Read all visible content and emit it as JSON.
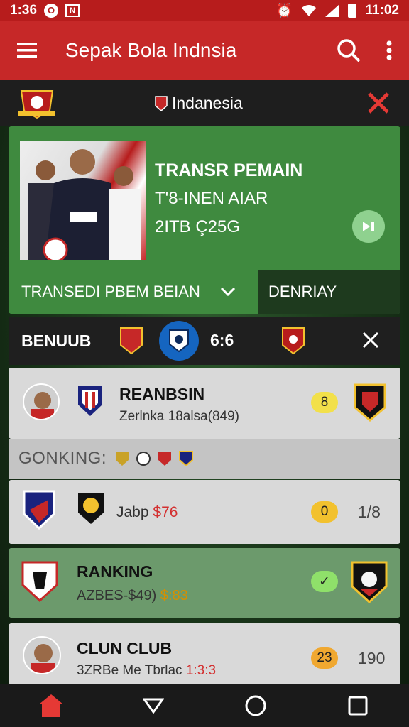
{
  "status_bar": {
    "time_left": "1:36",
    "time_right": "11:02",
    "notif_icon_1": "O",
    "notif_icon_2": "N"
  },
  "app_bar": {
    "title": "Sepak Bola Indnsia"
  },
  "team_header": {
    "name": "Indanesia"
  },
  "transfer_card": {
    "title": "TRANSR PEMAIN",
    "subtitle1": "T'8-INEN AIAR",
    "subtitle2": "2ITB Ç25G",
    "tab_label": "TRANSEDI PBEM BEIAN",
    "tab2_label": "DENRIAY"
  },
  "match_bar": {
    "label": "BENUUB",
    "score": "6:6"
  },
  "cards": [
    {
      "name": "REANBSIN",
      "sub": "Zerlnka 18alsa(849)",
      "pill": "8"
    },
    {
      "name": "",
      "sub_prefix": "Jabp",
      "sub_value": "$76",
      "pill": "0",
      "rank": "1/8"
    },
    {
      "name": "RANKING",
      "sub_prefix": "AZBES-$49)",
      "sub_value": "$:83",
      "pill": "✓"
    },
    {
      "name": "CLUN CLUB",
      "sub_prefix": "3ZRBe Me Tbrlac",
      "sub_value": "1:3:3",
      "pill": "23",
      "rank": "190"
    }
  ],
  "ranking_row": {
    "label": "GONKING:"
  },
  "colors": {
    "primary": "#c62828",
    "header_dark": "#1e1e1e",
    "transfer_green": "#3f8a3f",
    "card_grey": "#d9d9d9",
    "card_green": "#6c9a6c"
  }
}
